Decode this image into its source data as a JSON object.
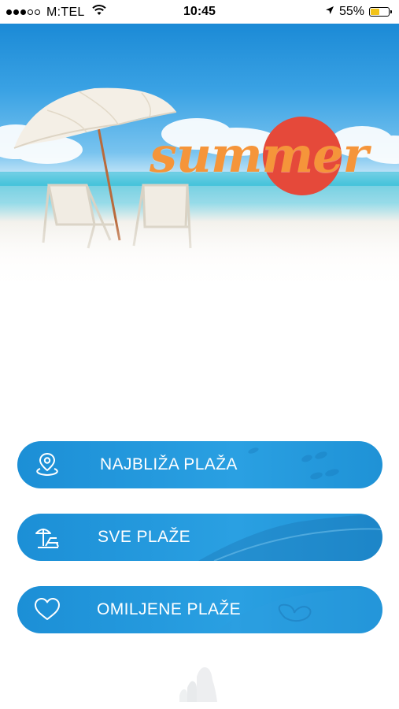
{
  "status_bar": {
    "carrier": "M:TEL",
    "time": "10:45",
    "battery_percent": "55%",
    "battery_level": 0.55,
    "signal_bars_filled": 3,
    "signal_bars_total": 5
  },
  "hero": {
    "logo_text": "summer",
    "colors": {
      "sun": "#e5493a",
      "text": "#f5953a",
      "sky": "#1b8ad6"
    }
  },
  "menu": {
    "items": [
      {
        "label": "NAJBLIŽA PLAŽA",
        "icon": "location-pin-icon"
      },
      {
        "label": "SVE PLAŽE",
        "icon": "beach-chair-umbrella-icon"
      },
      {
        "label": "OMILJENE PLAŽE",
        "icon": "heart-icon"
      }
    ],
    "button_color": "#2196d8"
  },
  "footer": {
    "icon": "app-logo-icon"
  }
}
